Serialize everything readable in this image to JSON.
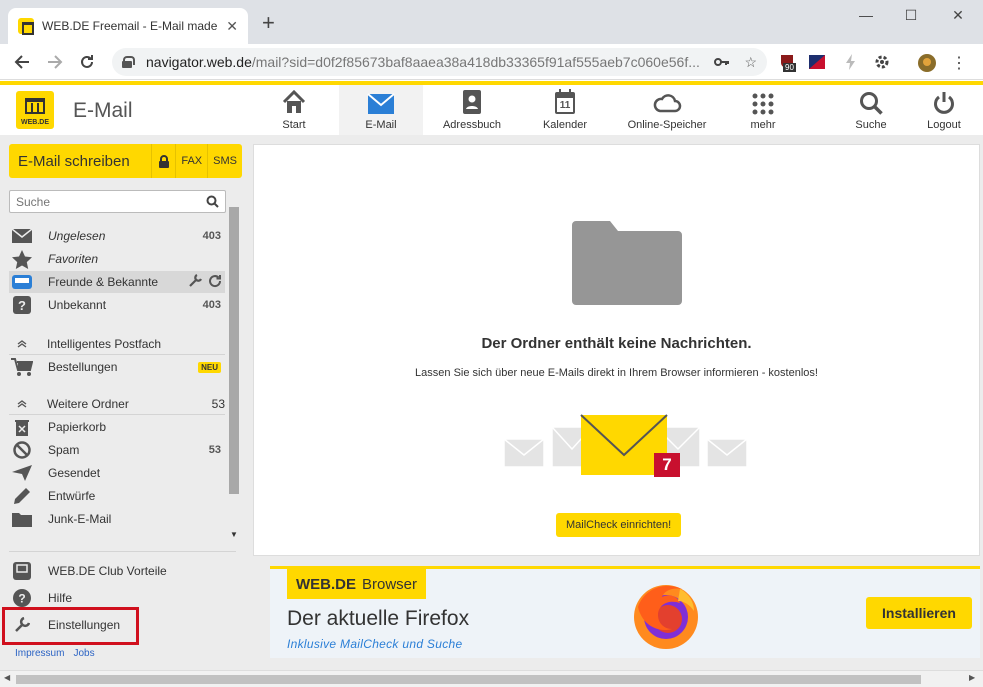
{
  "browser": {
    "tab_title": "WEB.DE Freemail - E-Mail made in Germany",
    "new_tab_symbol": "+",
    "url_host": "navigator.web.de",
    "url_rest": "/mail?sid=d0f2f85673baf8aaea38a418db33365f91af555aeb7c060e56f...",
    "extension_badge": "90"
  },
  "app": {
    "logo_text": "WEB.DE",
    "title": "E-Mail",
    "nav": [
      {
        "label": "Start"
      },
      {
        "label": "E-Mail"
      },
      {
        "label": "Adressbuch"
      },
      {
        "label": "Kalender",
        "day": "11"
      },
      {
        "label": "Online-Speicher"
      },
      {
        "label": "mehr"
      },
      {
        "label": "Suche"
      },
      {
        "label": "Logout"
      }
    ],
    "accent_color": "#ffd800"
  },
  "compose": {
    "label": "E-Mail schreiben",
    "fax": "FAX",
    "sms": "SMS"
  },
  "sidebar": {
    "search_placeholder": "Suche",
    "folders": [
      {
        "label": "Ungelesen",
        "count": "403",
        "icon": "envelope-icon"
      },
      {
        "label": "Favoriten",
        "count": "",
        "icon": "star-icon"
      },
      {
        "label": "Freunde & Bekannte",
        "count": "",
        "icon": "inbox-icon"
      },
      {
        "label": "Unbekannt",
        "count": "403",
        "icon": "question-icon"
      }
    ],
    "section_smart": "Intelligentes Postfach",
    "smart_items": [
      {
        "label": "Bestellungen",
        "badge": "NEU",
        "icon": "cart-icon"
      }
    ],
    "section_more": "Weitere Ordner",
    "section_more_count": "53",
    "more_items": [
      {
        "label": "Papierkorb",
        "count": "",
        "icon": "trash-icon"
      },
      {
        "label": "Spam",
        "count": "53",
        "icon": "spam-icon"
      },
      {
        "label": "Gesendet",
        "count": "",
        "icon": "send-icon"
      },
      {
        "label": "Entwürfe",
        "count": "",
        "icon": "pencil-icon"
      },
      {
        "label": "Junk-E-Mail",
        "count": "",
        "icon": "folder-icon"
      }
    ],
    "links": [
      {
        "label": "WEB.DE Club Vorteile"
      },
      {
        "label": "Hilfe"
      },
      {
        "label": "Einstellungen"
      }
    ],
    "footer": [
      "Impressum",
      "Jobs"
    ]
  },
  "main": {
    "empty_title": "Der Ordner enthält keine Nachrichten.",
    "empty_sub": "Lassen Sie sich über neue E-Mails direkt in Ihrem Browser informieren - kostenlos!",
    "badge_count": "7",
    "mailcheck_button": "MailCheck einrichten!"
  },
  "ad": {
    "label_brand": "WEB.DE",
    "label_product": "Browser",
    "headline": "Der aktuelle Firefox",
    "sub": "Inklusive MailCheck und Suche",
    "button": "Installieren"
  }
}
